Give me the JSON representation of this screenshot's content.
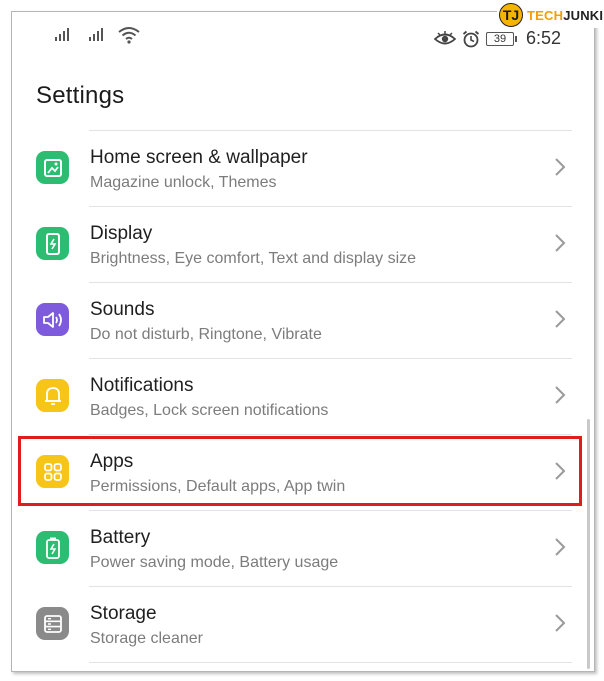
{
  "watermark": {
    "badge": "TJ",
    "part1": "TECH",
    "part2": "JUNKIE"
  },
  "statusbar": {
    "battery": "39",
    "time": "6:52"
  },
  "page": {
    "title": "Settings"
  },
  "items": [
    {
      "title": "Home screen & wallpaper",
      "subtitle": "Magazine unlock, Themes",
      "icon": "home-screen-icon",
      "color": "#2dbd72"
    },
    {
      "title": "Display",
      "subtitle": "Brightness, Eye comfort, Text and display size",
      "icon": "display-icon",
      "color": "#2dbd72"
    },
    {
      "title": "Sounds",
      "subtitle": "Do not disturb, Ringtone, Vibrate",
      "icon": "sound-icon",
      "color": "#7d5bdc"
    },
    {
      "title": "Notifications",
      "subtitle": "Badges, Lock screen notifications",
      "icon": "bell-icon",
      "color": "#f6c518"
    },
    {
      "title": "Apps",
      "subtitle": "Permissions, Default apps, App twin",
      "icon": "apps-grid-icon",
      "color": "#f6c518"
    },
    {
      "title": "Battery",
      "subtitle": "Power saving mode, Battery usage",
      "icon": "battery-icon",
      "color": "#2dbd72"
    },
    {
      "title": "Storage",
      "subtitle": "Storage cleaner",
      "icon": "storage-icon",
      "color": "#8a8a8a"
    }
  ],
  "highlight_color": "#e01c1c"
}
